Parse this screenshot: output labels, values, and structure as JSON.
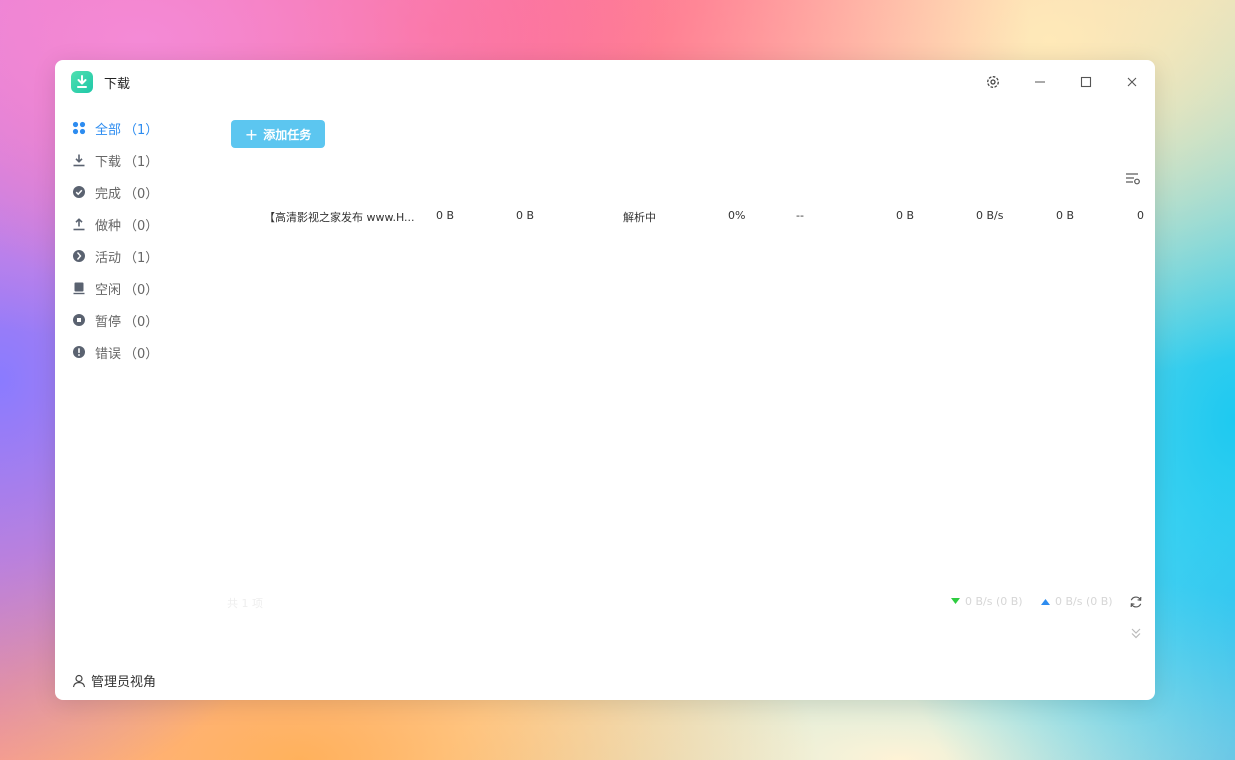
{
  "window": {
    "title": "下载"
  },
  "sidebar": {
    "items": [
      {
        "label": "全部",
        "count": "（1）",
        "icon": "grid-icon",
        "active": true
      },
      {
        "label": "下载",
        "count": "（1）",
        "icon": "download-icon",
        "active": false
      },
      {
        "label": "完成",
        "count": "（0）",
        "icon": "check-circle-icon",
        "active": false
      },
      {
        "label": "做种",
        "count": "（0）",
        "icon": "upload-icon",
        "active": false
      },
      {
        "label": "活动",
        "count": "（1）",
        "icon": "activity-icon",
        "active": false
      },
      {
        "label": "空闲",
        "count": "（0）",
        "icon": "idle-icon",
        "active": false
      },
      {
        "label": "暂停",
        "count": "（0）",
        "icon": "pause-circle-icon",
        "active": false
      },
      {
        "label": "错误",
        "count": "（0）",
        "icon": "error-circle-icon",
        "active": false
      }
    ],
    "admin_view": "管理员视角"
  },
  "toolbar": {
    "add_task": "添加任务"
  },
  "table": {
    "row": {
      "name": "【高清影视之家发布 www.H...",
      "size": "0 B",
      "downloaded": "0 B",
      "status": "解析中",
      "progress": "0%",
      "eta": "--",
      "uploaded": "0 B",
      "speed": "0 B/s",
      "remaining": "0 B",
      "last": "0"
    }
  },
  "footer": {
    "count": "共 1 项",
    "download_speed": "0 B/s (0 B)",
    "upload_speed": "0 B/s (0 B)"
  },
  "colors": {
    "accent": "#2d8cf0",
    "add_button": "#5cc6f0",
    "download_arrow": "#2ecc40",
    "upload_arrow": "#2d8cf0"
  }
}
